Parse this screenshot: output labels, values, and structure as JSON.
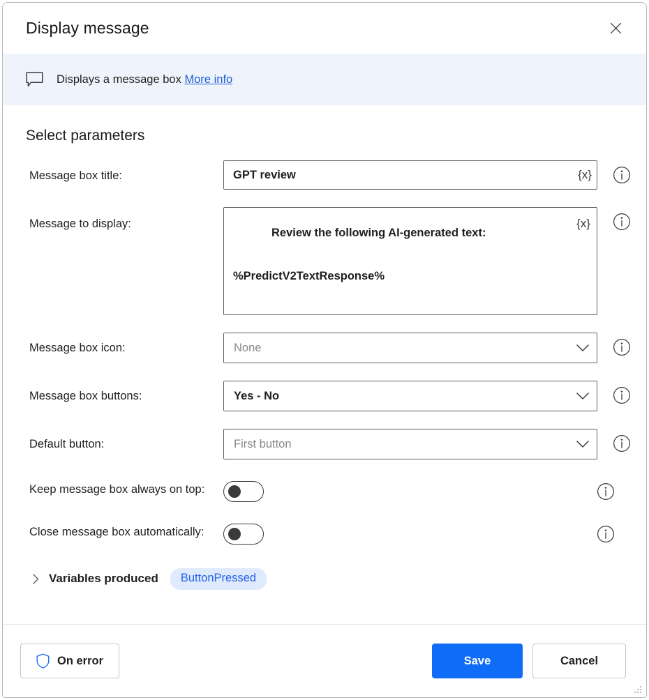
{
  "window": {
    "title": "Display message",
    "close_icon": "close-icon"
  },
  "infobar": {
    "icon": "message-box-icon",
    "text": "Displays a message box",
    "link_label": "More info"
  },
  "main": {
    "section_title": "Select parameters",
    "fields": [
      {
        "label": "Message box title:",
        "type": "text",
        "value": "GPT review",
        "variable_button": "{x}",
        "info_icon": "info-icon"
      },
      {
        "label": "Message to display:",
        "type": "textarea",
        "value_line1": "Review the following AI-generated text:",
        "value_line2": "%PredictV2TextResponse%",
        "variable_button": "{x}",
        "info_icon": "info-icon"
      },
      {
        "label": "Message box icon:",
        "type": "dropdown",
        "value": "None",
        "is_default": true,
        "info_icon": "info-icon"
      },
      {
        "label": "Message box buttons:",
        "type": "dropdown",
        "value": "Yes - No",
        "is_default": false,
        "info_icon": "info-icon"
      },
      {
        "label": "Default button:",
        "type": "dropdown",
        "value": "First button",
        "is_default": true,
        "info_icon": "info-icon"
      },
      {
        "label": "Keep message box always on top:",
        "type": "toggle",
        "value": "off",
        "info_icon": "info-icon"
      },
      {
        "label": "Close message box automatically:",
        "type": "toggle",
        "value": "off",
        "info_icon": "info-icon"
      }
    ],
    "variables_produced": {
      "label": "Variables produced",
      "expanded": false,
      "chevron_icon": "chevron-right-icon",
      "chips": [
        "ButtonPressed"
      ]
    }
  },
  "footer": {
    "on_error_label": "On error",
    "on_error_icon": "shield-icon",
    "save_label": "Save",
    "cancel_label": "Cancel"
  },
  "colors": {
    "accent": "#0f6cf6",
    "link": "#1a5fd6",
    "infobar_bg": "#eff3fc",
    "chip_bg": "#dfeafc",
    "chip_text": "#2563eb",
    "field_border": "#605e5c",
    "placeholder_text": "#8a8886"
  }
}
